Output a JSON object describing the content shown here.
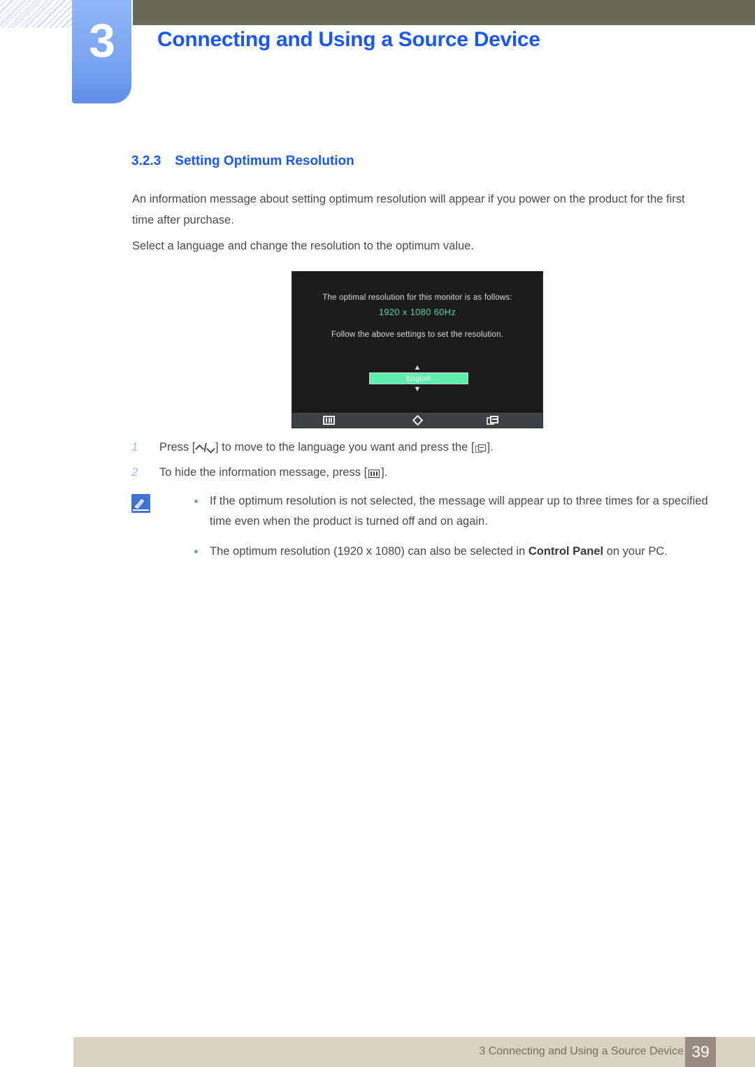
{
  "chapter": {
    "number": "3",
    "title": "Connecting and Using a Source Device"
  },
  "section": {
    "number": "3.2.3",
    "title": "Setting Optimum Resolution"
  },
  "paragraphs": [
    "An information message about setting optimum resolution will appear if you power on the product for the first time after purchase.",
    "Select a language and change the resolution to the optimum value."
  ],
  "osd": {
    "line1": "The optimal resolution for this monitor is as follows:",
    "resolution": "1920 x 1080  60Hz",
    "line2": "Follow the above settings to set the resolution.",
    "language_value": "English",
    "arrow_up": "▲",
    "arrow_down": "▼",
    "highlight_color": "#5eeeb0",
    "resolution_color": "#4fd6a0",
    "background_color": "#1c1c1c",
    "bottom_bar_color": "#3a4043",
    "icons": [
      "menu-icon",
      "diamond-icon",
      "enter-icon"
    ]
  },
  "steps": [
    {
      "number": "1",
      "text_before": "Press [",
      "icon_1": "up-down-arrows-icon",
      "text_middle": "] to move to the language you want and press the [",
      "icon_2": "enter-icon",
      "text_after": "]."
    },
    {
      "number": "2",
      "text_before": "To hide the information message, press [",
      "icon_1": "menu-icon",
      "text_after": "]."
    }
  ],
  "note": {
    "icon": "note-pencil-icon",
    "items": [
      {
        "text": "If the optimum resolution is not selected, the message will appear up to three times for a specified time even when the product is turned off and on again."
      },
      {
        "text_before": "The optimum resolution (1920 x 1080) can also be selected in ",
        "bold": "Control Panel",
        "text_after": " on your PC."
      }
    ]
  },
  "footer": {
    "text": "3 Connecting and Using a Source Device",
    "page_number": "39",
    "bar_color": "#d8d3c0",
    "page_box_color": "#9a8a81"
  },
  "theme": {
    "heading_blue": "#1a56f0",
    "header_olive": "#6b6b55",
    "tab_blue": "#7ba5f0"
  }
}
